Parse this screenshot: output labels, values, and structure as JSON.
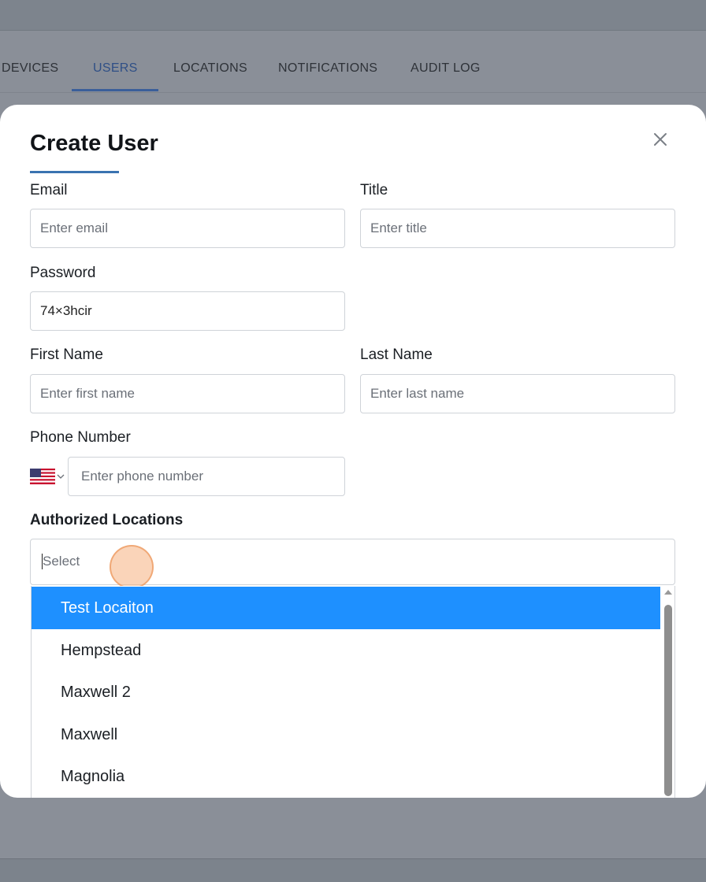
{
  "tabs": [
    {
      "label": "DEVICES",
      "active": false
    },
    {
      "label": "USERS",
      "active": true
    },
    {
      "label": "LOCATIONS",
      "active": false
    },
    {
      "label": "NOTIFICATIONS",
      "active": false
    },
    {
      "label": "AUDIT LOG",
      "active": false
    }
  ],
  "modal": {
    "title": "Create User",
    "close_icon": "close-icon"
  },
  "form": {
    "email": {
      "label": "Email",
      "value": "",
      "placeholder": "Enter email"
    },
    "title": {
      "label": "Title",
      "value": "",
      "placeholder": "Enter title"
    },
    "password": {
      "label": "Password",
      "value": "74×3hcir",
      "placeholder": ""
    },
    "first_name": {
      "label": "First Name",
      "value": "",
      "placeholder": "Enter first name"
    },
    "last_name": {
      "label": "Last Name",
      "value": "",
      "placeholder": "Enter last name"
    },
    "phone": {
      "label": "Phone Number",
      "value": "",
      "placeholder": "Enter phone number",
      "country_flag": "us-flag-icon"
    },
    "locations": {
      "label": "Authorized Locations",
      "placeholder": "Select",
      "options": [
        "Test Locaiton",
        "Hempstead",
        "Maxwell 2",
        "Maxwell",
        "Magnolia"
      ],
      "highlighted": "Test Locaiton"
    }
  },
  "colors": {
    "accent": "#3a73b0",
    "active_tab": "#2f4f86",
    "option_highlight": "#1e90ff",
    "overlay": "#8a8f98"
  }
}
